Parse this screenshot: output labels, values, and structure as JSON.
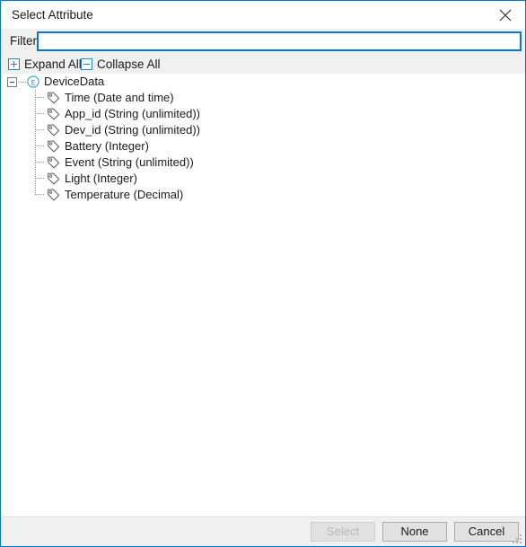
{
  "window": {
    "title": "Select Attribute",
    "close_icon": "close-icon",
    "border_color": "#0078d7"
  },
  "filter": {
    "label": "Filter",
    "value": "",
    "placeholder": ""
  },
  "toolbar": {
    "expand_all_label": "Expand All",
    "collapse_all_label": "Collapse All",
    "expand_icon": "plus-box-icon",
    "collapse_icon": "minus-box-icon"
  },
  "tree": {
    "root": {
      "label": "DeviceData",
      "icon": "entity-circle-e-icon",
      "expanded": true,
      "expander_icon": "minus-expander-icon"
    },
    "children": [
      {
        "label": "Time (Date and time)",
        "icon": "tag-icon"
      },
      {
        "label": "App_id (String (unlimited))",
        "icon": "tag-icon"
      },
      {
        "label": "Dev_id (String (unlimited))",
        "icon": "tag-icon"
      },
      {
        "label": "Battery (Integer)",
        "icon": "tag-icon"
      },
      {
        "label": "Event (String (unlimited))",
        "icon": "tag-icon"
      },
      {
        "label": "Light (Integer)",
        "icon": "tag-icon"
      },
      {
        "label": "Temperature (Decimal)",
        "icon": "tag-icon"
      }
    ]
  },
  "footer": {
    "select_label": "Select",
    "select_disabled": true,
    "none_label": "None",
    "cancel_label": "Cancel",
    "resize_grip": "resize-grip-icon"
  }
}
